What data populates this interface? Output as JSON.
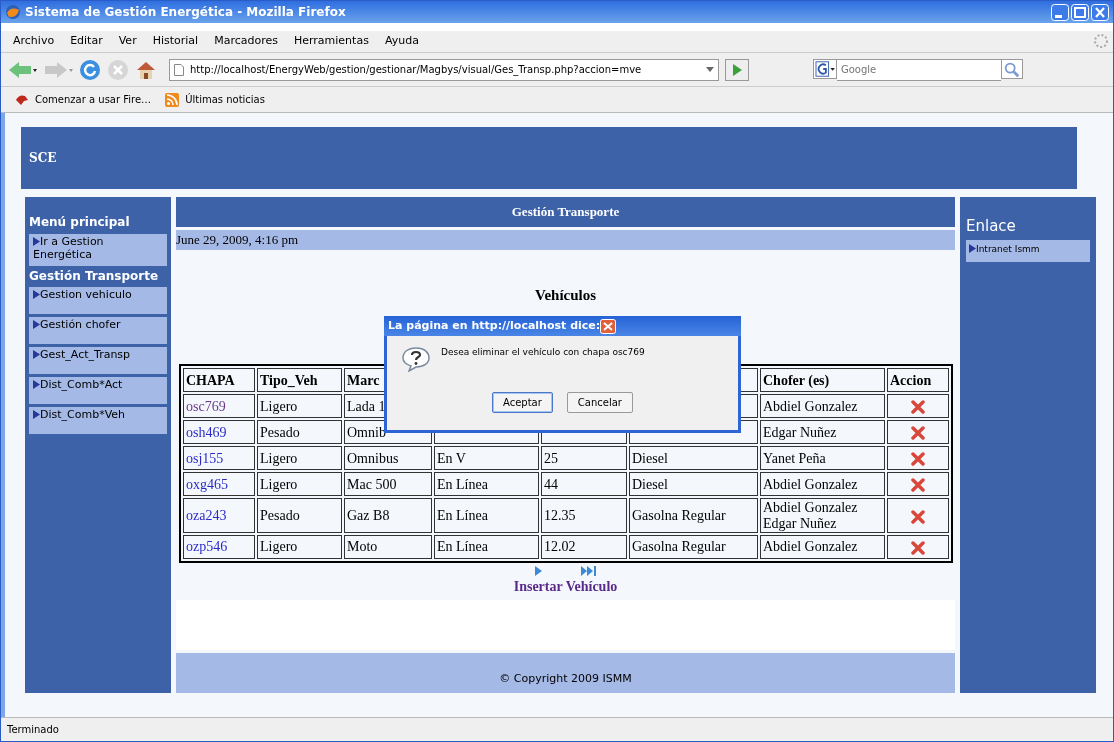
{
  "window": {
    "title": "Sistema de Gestión Energética - Mozilla Firefox"
  },
  "menu": [
    "Archivo",
    "Editar",
    "Ver",
    "Historial",
    "Marcadores",
    "Herramientas",
    "Ayuda"
  ],
  "toolbar": {
    "url": "http://localhost/EnergyWeb/gestion/gestionar/Magbys/visual/Ges_Transp.php?accion=mve",
    "search_placeholder": "Google"
  },
  "bookmarks": [
    "Comenzar a usar Fire…",
    "Últimas noticias"
  ],
  "page": {
    "header": "SCE",
    "left_menu": {
      "title": "Menú principal",
      "items": [
        {
          "kind": "link",
          "label": "Ir a Gestion Energética"
        },
        {
          "kind": "heading",
          "label": "Gestión Transporte"
        },
        {
          "kind": "link",
          "label": "Gestion vehiculo"
        },
        {
          "kind": "link",
          "label": "Gestión chofer"
        },
        {
          "kind": "link",
          "label": "Gest_Act_Transp"
        },
        {
          "kind": "link",
          "label": "Dist_Comb*Act"
        },
        {
          "kind": "link",
          "label": "Dist_Comb*Veh"
        }
      ]
    },
    "right_menu": {
      "title": "Enlace",
      "items": [
        "Intranet Ismm"
      ]
    },
    "main": {
      "title": "Gestión Transporte",
      "date": "June 29, 2009, 4:16 pm",
      "section_title": "Vehículos",
      "table": {
        "columns": [
          "CHAPA",
          "Tipo_Veh",
          "Marc",
          null,
          null,
          null,
          "Chofer (es)",
          "Accion"
        ],
        "rows": [
          {
            "visited": true,
            "cells": [
              "osc769",
              "Ligero",
              "Lada 1",
              null,
              null,
              null
            ],
            "drivers": [
              "Abdiel Gonzalez"
            ]
          },
          {
            "visited": false,
            "cells": [
              "osh469",
              "Pesado",
              "Omnib",
              null,
              null,
              null
            ],
            "drivers": [
              "Edgar Nuñez"
            ]
          },
          {
            "visited": false,
            "cells": [
              "osj155",
              "Ligero",
              "Omnibus",
              "En V",
              "25",
              "Diesel"
            ],
            "drivers": [
              "Yanet Peña"
            ]
          },
          {
            "visited": false,
            "cells": [
              "oxg465",
              "Ligero",
              "Mac 500",
              "En Línea",
              "44",
              "Diesel"
            ],
            "drivers": [
              "Abdiel Gonzalez"
            ]
          },
          {
            "visited": false,
            "cells": [
              "oza243",
              "Pesado",
              "Gaz B8",
              "En Línea",
              "12.35",
              "Gasolna Regular"
            ],
            "drivers": [
              "Abdiel Gonzalez",
              "Edgar Nuñez"
            ]
          },
          {
            "visited": false,
            "cells": [
              "ozp546",
              "Ligero",
              "Moto",
              "En Línea",
              "12.02",
              "Gasolna Regular"
            ],
            "drivers": [
              "Abdiel Gonzalez"
            ]
          }
        ]
      },
      "insert_link": "Insertar Vehículo",
      "footer": "© Copyright 2009 ISMM"
    }
  },
  "dialog": {
    "title": "La página en http://localhost dice:",
    "message": "Desea eliminar el vehículo con chapa  osc769",
    "buttons": [
      {
        "label": "Aceptar",
        "selected": true
      },
      {
        "label": "Cancelar",
        "selected": false
      }
    ]
  },
  "status_bar": "Terminado"
}
